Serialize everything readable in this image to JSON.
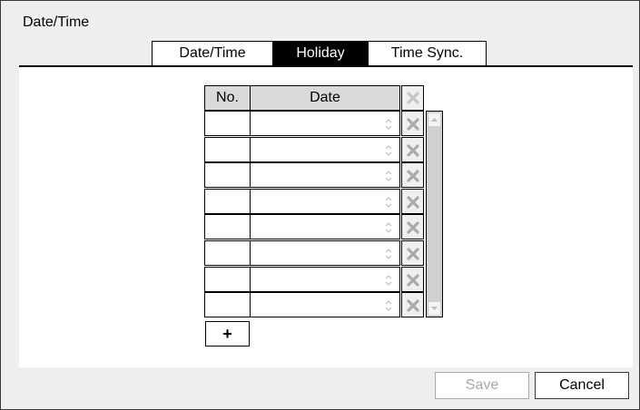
{
  "window": {
    "title": "Date/Time"
  },
  "tabs": [
    {
      "label": "Date/Time",
      "active": false
    },
    {
      "label": "Holiday",
      "active": true
    },
    {
      "label": "Time Sync.",
      "active": false
    }
  ],
  "table": {
    "columns": {
      "no": "No.",
      "date": "Date"
    },
    "rows": [
      {
        "no": "",
        "date": ""
      },
      {
        "no": "",
        "date": ""
      },
      {
        "no": "",
        "date": ""
      },
      {
        "no": "",
        "date": ""
      },
      {
        "no": "",
        "date": ""
      },
      {
        "no": "",
        "date": ""
      },
      {
        "no": "",
        "date": ""
      },
      {
        "no": "",
        "date": ""
      }
    ]
  },
  "buttons": {
    "add_label": "+",
    "save_label": "Save",
    "cancel_label": "Cancel"
  },
  "colors": {
    "tab_active_bg": "#000000",
    "panel_bg": "#efefef",
    "disabled_text": "#a8a8a8",
    "icon_gray": "#aaaaaa"
  },
  "icons": {
    "delete": "x-icon",
    "spin": "up-down-icon",
    "scroll_up": "chevron-up-icon",
    "scroll_down": "chevron-down-icon"
  }
}
